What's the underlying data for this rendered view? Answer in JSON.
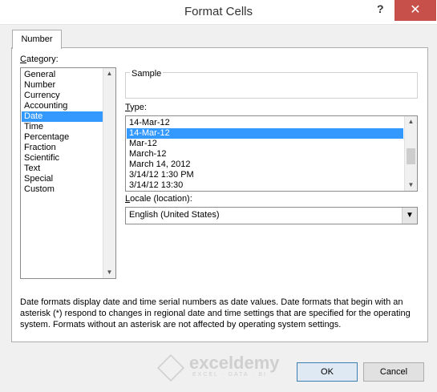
{
  "window": {
    "title": "Format Cells",
    "help_label": "?",
    "close_label": "✕"
  },
  "tabs": [
    {
      "label": "Number",
      "active": true
    }
  ],
  "category": {
    "label": "Category:",
    "items": [
      "General",
      "Number",
      "Currency",
      "Accounting",
      "Date",
      "Time",
      "Percentage",
      "Fraction",
      "Scientific",
      "Text",
      "Special",
      "Custom"
    ],
    "selected": "Date"
  },
  "sample": {
    "label": "Sample",
    "value": ""
  },
  "type": {
    "label": "Type:",
    "input_value": "14-Mar-12",
    "items": [
      "14-Mar-12",
      "Mar-12",
      "March-12",
      "March 14, 2012",
      "3/14/12 1:30 PM",
      "3/14/12 13:30"
    ],
    "selected": "14-Mar-12"
  },
  "locale": {
    "label": "Locale (location):",
    "value": "English (United States)"
  },
  "description": "Date formats display date and time serial numbers as date values.  Date formats that begin with an asterisk (*) respond to changes in regional date and time settings that are specified for the operating system. Formats without an asterisk are not affected by operating system settings.",
  "watermark": {
    "name": "exceldemy",
    "tagline": "EXCEL · DATA · BI"
  },
  "buttons": {
    "ok": "OK",
    "cancel": "Cancel"
  },
  "colors": {
    "selection": "#3399ff",
    "close": "#c7514a"
  }
}
